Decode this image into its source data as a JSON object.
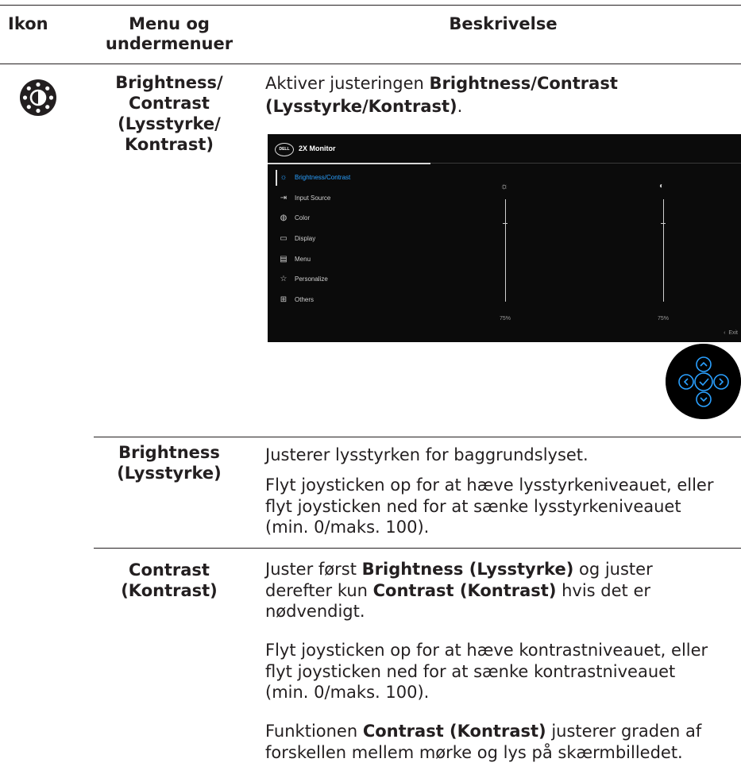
{
  "header": {
    "col_icon": "Ikon",
    "col_menu_line1": "Menu og",
    "col_menu_line2": "undermenuer",
    "col_desc": "Beskrivelse"
  },
  "row_main": {
    "icon_name": "brightness-contrast-icon",
    "menu_lines": [
      "Brightness/",
      "Contrast",
      "(Lysstyrke/",
      "Kontrast)"
    ],
    "desc_prefix": "Aktiver justeringen ",
    "desc_bold": "Brightness/Contrast (Lysstyrke/Kontrast)",
    "desc_suffix": "."
  },
  "osd": {
    "logo": "DELL",
    "title": "2X Monitor",
    "items": [
      {
        "label": "Brightness/Contrast",
        "icon": "sun-icon",
        "glyph": "☼"
      },
      {
        "label": "Input Source",
        "icon": "input-source-icon",
        "glyph": "⇥"
      },
      {
        "label": "Color",
        "icon": "palette-icon",
        "glyph": "◍"
      },
      {
        "label": "Display",
        "icon": "display-icon",
        "glyph": "▭"
      },
      {
        "label": "Menu",
        "icon": "menu-icon",
        "glyph": "▤"
      },
      {
        "label": "Personalize",
        "icon": "star-icon",
        "glyph": "☆"
      },
      {
        "label": "Others",
        "icon": "others-icon",
        "glyph": "⊞"
      }
    ],
    "brightness_icon": "☼",
    "contrast_icon": "◐",
    "brightness_value": "75%",
    "contrast_value": "75%",
    "exit": "Exit",
    "exit_glyph": "‹"
  },
  "sub_brightness": {
    "menu_lines": [
      "Brightness",
      "(Lysstyrke)"
    ],
    "para1": "Justerer lysstyrken for baggrundslyset.",
    "para2_lines": [
      "Flyt joysticken op for at hæve lysstyrkeniveauet, eller",
      "flyt joysticken ned for at sænke lysstyrkeniveauet",
      "(min. 0/maks. 100)."
    ]
  },
  "sub_contrast": {
    "menu_lines": [
      "Contrast",
      "(Kontrast)"
    ],
    "p1_a": "Juster først ",
    "p1_b": "Brightness (Lysstyrke)",
    "p1_c": " og juster",
    "p1_d": "derefter kun ",
    "p1_e": "Contrast (Kontrast)",
    "p1_f": " hvis det er",
    "p1_g": "nødvendigt.",
    "p2_lines": [
      "Flyt joysticken op for at hæve kontrastniveauet, eller",
      "flyt joysticken ned for at sænke kontrastniveauet",
      "(min. 0/maks. 100)."
    ],
    "p3_a": "Funktionen ",
    "p3_b": "Contrast (Kontrast)",
    "p3_c": " justerer graden af",
    "p3_d": "forskellen mellem mørke og lys på skærmbilledet."
  }
}
